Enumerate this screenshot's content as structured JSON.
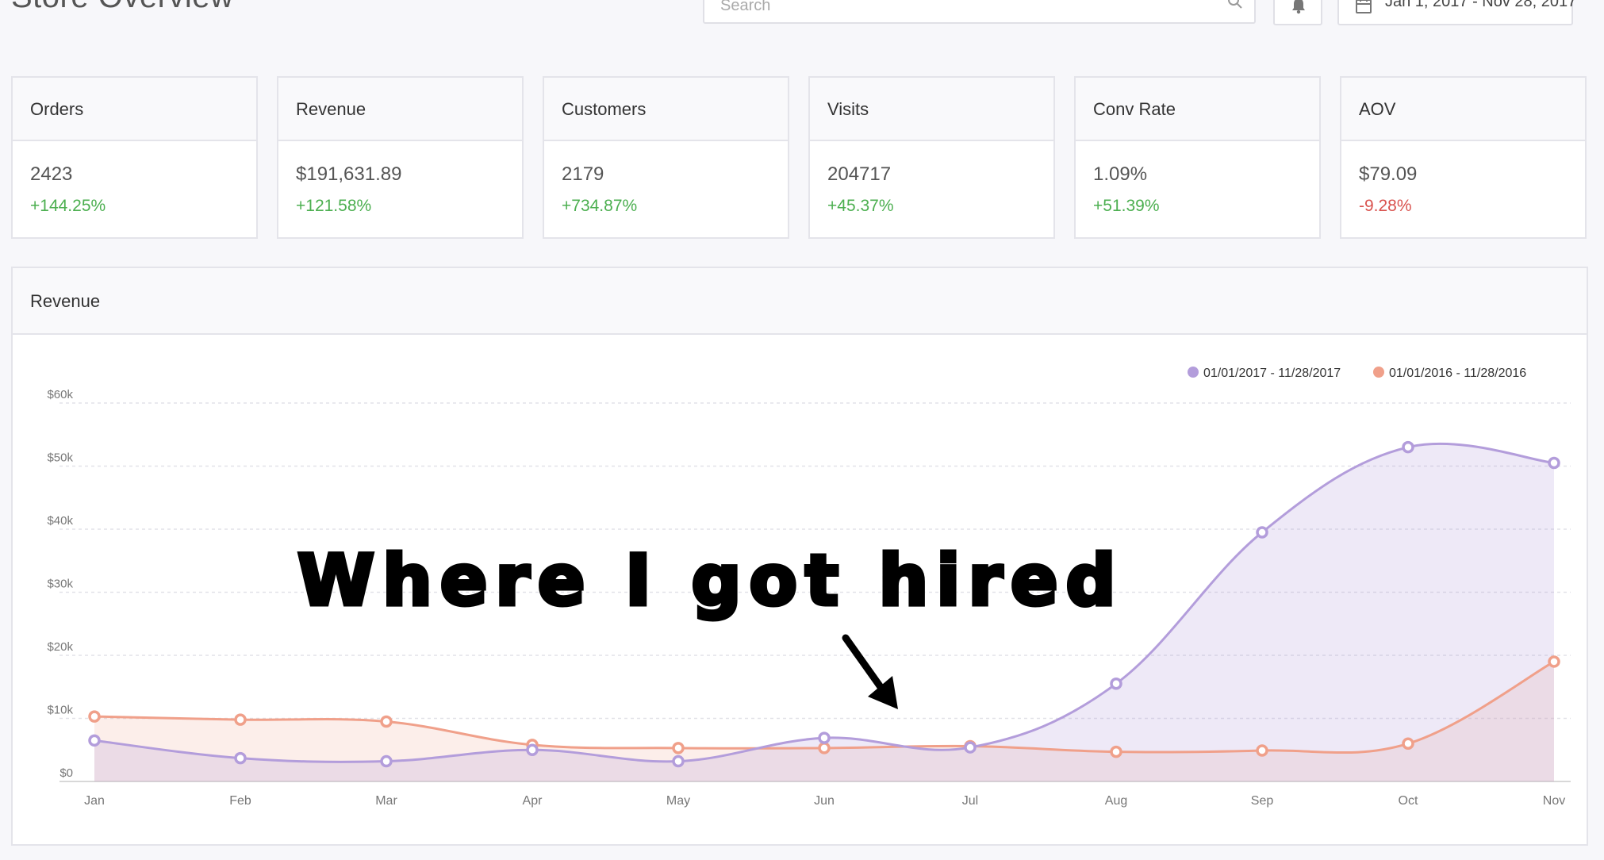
{
  "header": {
    "title": "Store Overview",
    "search_placeholder": "Search",
    "date_range": "Jan 1, 2017 - Nov 28, 2017"
  },
  "kpis": [
    {
      "label": "Orders",
      "value": "2423",
      "change": "+144.25%",
      "trend": "up"
    },
    {
      "label": "Revenue",
      "value": "$191,631.89",
      "change": "+121.58%",
      "trend": "up"
    },
    {
      "label": "Customers",
      "value": "2179",
      "change": "+734.87%",
      "trend": "up"
    },
    {
      "label": "Visits",
      "value": "204717",
      "change": "+45.37%",
      "trend": "up"
    },
    {
      "label": "Conv Rate",
      "value": "1.09%",
      "change": "+51.39%",
      "trend": "up"
    },
    {
      "label": "AOV",
      "value": "$79.09",
      "change": "-9.28%",
      "trend": "down"
    }
  ],
  "revenue_panel": {
    "title": "Revenue"
  },
  "annotation": {
    "text": "Where I got hired"
  },
  "colors": {
    "current": "#b39ddb",
    "previous": "#f0a08a",
    "positive": "#4caf50",
    "negative": "#d9534f"
  },
  "chart_data": {
    "type": "area",
    "categories": [
      "Jan",
      "Feb",
      "Mar",
      "Apr",
      "May",
      "Jun",
      "Jul",
      "Aug",
      "Sep",
      "Oct",
      "Nov"
    ],
    "yticks": [
      "$0",
      "$10k",
      "$20k",
      "$30k",
      "$40k",
      "$50k",
      "$60k"
    ],
    "ylim": [
      0,
      60000
    ],
    "grid": true,
    "legend_position": "top-right",
    "series": [
      {
        "name": "01/01/2017 - 11/28/2017",
        "values": [
          6500,
          3700,
          3200,
          5000,
          3200,
          6900,
          5400,
          15500,
          39500,
          53000,
          50500
        ]
      },
      {
        "name": "01/01/2016 - 11/28/2016",
        "values": [
          10300,
          9800,
          9500,
          5800,
          5300,
          5300,
          5600,
          4700,
          4900,
          6000,
          19000
        ]
      }
    ]
  }
}
